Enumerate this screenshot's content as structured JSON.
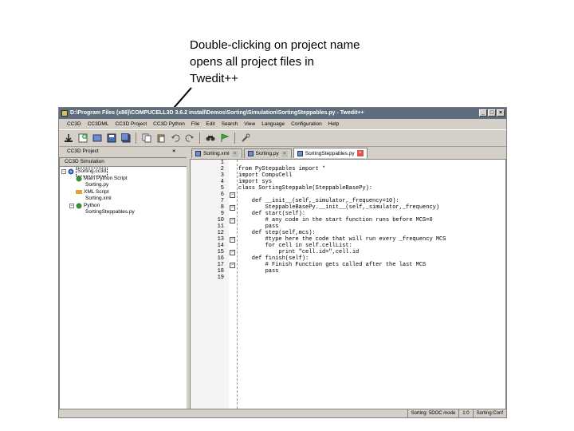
{
  "caption": {
    "line1": "Double-clicking on project name",
    "line2": "opens all project files in",
    "line3": "Twedit++"
  },
  "window": {
    "title": "D:\\Program Files (x86)\\COMPUCELL3D 3.6.2 install\\Demos\\Sorting\\Simulation\\SortingSteppables.py - Twedit++",
    "controls": [
      "_",
      "□",
      "×"
    ]
  },
  "menu": [
    "CC3D",
    "CC3DML",
    "CC3D Project",
    "CC3D Python",
    "File",
    "Edit",
    "Search",
    "View",
    "Language",
    "Configuration",
    "Help"
  ],
  "toolbar": [
    "new-file-icon",
    "add-icon",
    "open-icon",
    "save-icon",
    "save-all-icon",
    "copy-icon",
    "paste-icon",
    "undo-icon",
    "redo-icon",
    "find-icon",
    "run-icon",
    "settings-icon"
  ],
  "left_panel": {
    "title": "CC3D Project",
    "close": "×",
    "tree_header": "CC3D Simulation",
    "tree": [
      {
        "label": "Sorting.cc3d",
        "indent": 0,
        "expander": "−",
        "icon": "project-icon",
        "selected": true
      },
      {
        "label": "Main Python Script",
        "indent": 1,
        "expander": "",
        "icon": "python-icon",
        "selected": false
      },
      {
        "label": "Sorting.py",
        "indent": 2,
        "expander": "",
        "icon": "",
        "selected": false
      },
      {
        "label": "XML Script",
        "indent": 1,
        "expander": "",
        "icon": "xml-icon",
        "selected": false
      },
      {
        "label": "Sorting.xml",
        "indent": 2,
        "expander": "",
        "icon": "",
        "selected": false
      },
      {
        "label": "Python",
        "indent": 1,
        "expander": "−",
        "icon": "python-icon",
        "selected": false
      },
      {
        "label": "SortingSteppables.py",
        "indent": 2,
        "expander": "",
        "icon": "",
        "selected": false
      }
    ]
  },
  "tabs": [
    {
      "label": "Sorting.xml",
      "active": false
    },
    {
      "label": "Sorting.py",
      "active": false
    },
    {
      "label": "SortingSteppables.py",
      "active": true
    }
  ],
  "code": {
    "line_numbers": [
      "1",
      "2",
      "3",
      "4",
      "5",
      "6",
      "7",
      "8",
      "9",
      "10",
      "11",
      "12",
      "13",
      "14",
      "15",
      "16",
      "17",
      "18",
      "19"
    ],
    "lines": [
      "",
      "from PySteppables import *",
      "import CompuCell",
      "import sys",
      "class SortingSteppable(SteppableBasePy):",
      "",
      "    def __init__(self,_simulator,_frequency=10):",
      "        SteppableBasePy.__init__(self,_simulator,_frequency)",
      "    def start(self):",
      "        # any code in the start function runs before MCS=0",
      "        pass",
      "    def step(self,mcs):",
      "        #type here the code that will run every _frequency MCS",
      "        for cell in self.cellList:",
      "            print \"cell.id=\",cell.id",
      "    def finish(self):",
      "        # Finish Function gets called after the last MCS",
      "        pass",
      ""
    ]
  },
  "status": {
    "encoding": "Sorting: 5DOC mode",
    "position": "1:0",
    "extra": "Sorting:Conf"
  }
}
